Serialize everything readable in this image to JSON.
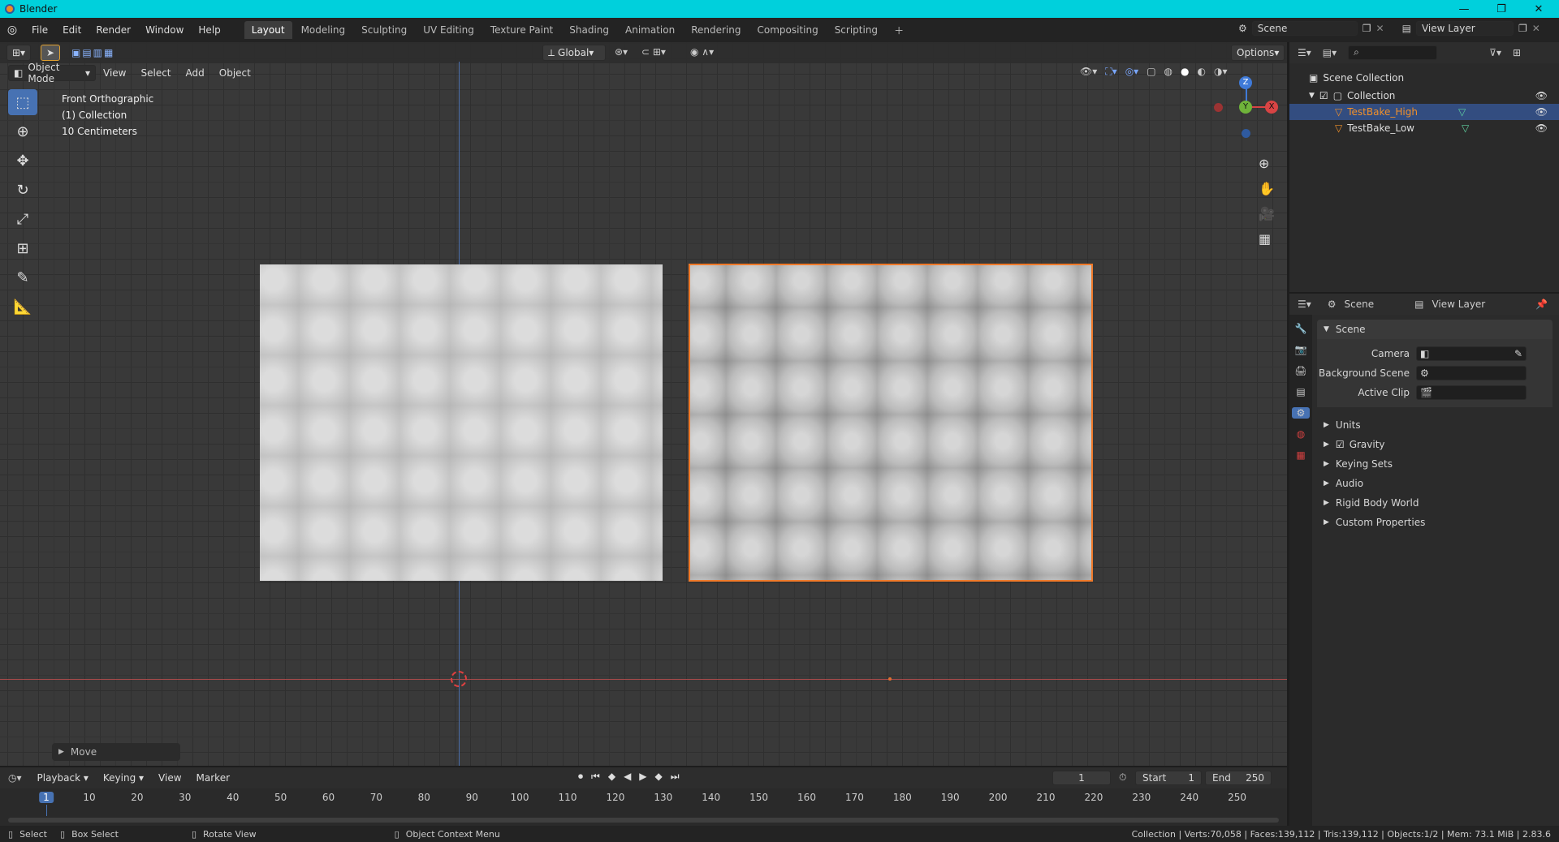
{
  "window": {
    "title": "Blender"
  },
  "menus": [
    "File",
    "Edit",
    "Render",
    "Window",
    "Help"
  ],
  "workspaces": [
    "Layout",
    "Modeling",
    "Sculpting",
    "UV Editing",
    "Texture Paint",
    "Shading",
    "Animation",
    "Rendering",
    "Compositing",
    "Scripting"
  ],
  "active_workspace": "Layout",
  "top_right": {
    "scene": "Scene",
    "view_layer": "View Layer"
  },
  "toolbar": {
    "transform": "Global",
    "options": "Options"
  },
  "viewport_header": {
    "mode": "Object Mode",
    "menus": [
      "View",
      "Select",
      "Add",
      "Object"
    ]
  },
  "viewport_info": {
    "view": "Front Orthographic",
    "collection": "(1) Collection",
    "scale": "10 Centimeters"
  },
  "gizmo": {
    "z": "Z",
    "y": "Y",
    "x": "X"
  },
  "operator_panel": "Move",
  "outliner": {
    "root": "Scene Collection",
    "collection": "Collection",
    "objects": [
      "TestBake_High",
      "TestBake_Low"
    ],
    "selected": "TestBake_High"
  },
  "properties": {
    "tabs": {
      "scene": "Scene",
      "view_layer": "View Layer"
    },
    "section": "Scene",
    "fields": [
      {
        "label": "Camera"
      },
      {
        "label": "Background Scene"
      },
      {
        "label": "Active Clip"
      }
    ],
    "panels": [
      "Units",
      "Gravity",
      "Keying Sets",
      "Audio",
      "Rigid Body World",
      "Custom Properties"
    ]
  },
  "timeline": {
    "menus": [
      "Playback",
      "Keying",
      "View",
      "Marker"
    ],
    "current_frame": "1",
    "start_label": "Start",
    "start": "1",
    "end_label": "End",
    "end": "250",
    "ticks": [
      "1",
      "10",
      "20",
      "30",
      "40",
      "50",
      "60",
      "70",
      "80",
      "90",
      "100",
      "110",
      "120",
      "130",
      "140",
      "150",
      "160",
      "170",
      "180",
      "190",
      "200",
      "210",
      "220",
      "230",
      "240",
      "250"
    ]
  },
  "statusbar": {
    "select": "Select",
    "box_select": "Box Select",
    "rotate": "Rotate View",
    "context": "Object Context Menu",
    "stats": "Collection | Verts:70,058 | Faces:139,112 | Tris:139,112 | Objects:1/2 | Mem: 73.1 MiB | 2.83.6"
  },
  "colors": {
    "accent": "#4772b3",
    "selection": "#f07a2a",
    "titlebar": "#00d0dc"
  }
}
